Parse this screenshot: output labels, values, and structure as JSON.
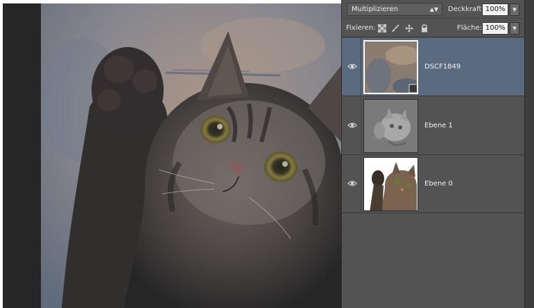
{
  "layers_panel": {
    "blend_mode": "Multiplizieren",
    "opacity_label": "Deckkraft:",
    "opacity_value": "100%",
    "lock_label": "Fixieren:",
    "fill_label": "Fläche:",
    "fill_value": "100%",
    "layers": [
      {
        "name": "DSCF1849",
        "visible": true,
        "selected": true
      },
      {
        "name": "Ebene 1",
        "visible": true,
        "selected": false
      },
      {
        "name": "Ebene 0",
        "visible": true,
        "selected": false
      }
    ]
  },
  "icons": {
    "eye": "eye-icon",
    "lock_transparent": "checker-lock-icon",
    "lock_paint": "brush-lock-icon",
    "lock_move": "move-lock-icon",
    "lock_all": "padlock-icon"
  },
  "colors": {
    "panel_bg": "#535353",
    "selected_layer": "#5a6b80",
    "dark_strip": "#262626"
  }
}
